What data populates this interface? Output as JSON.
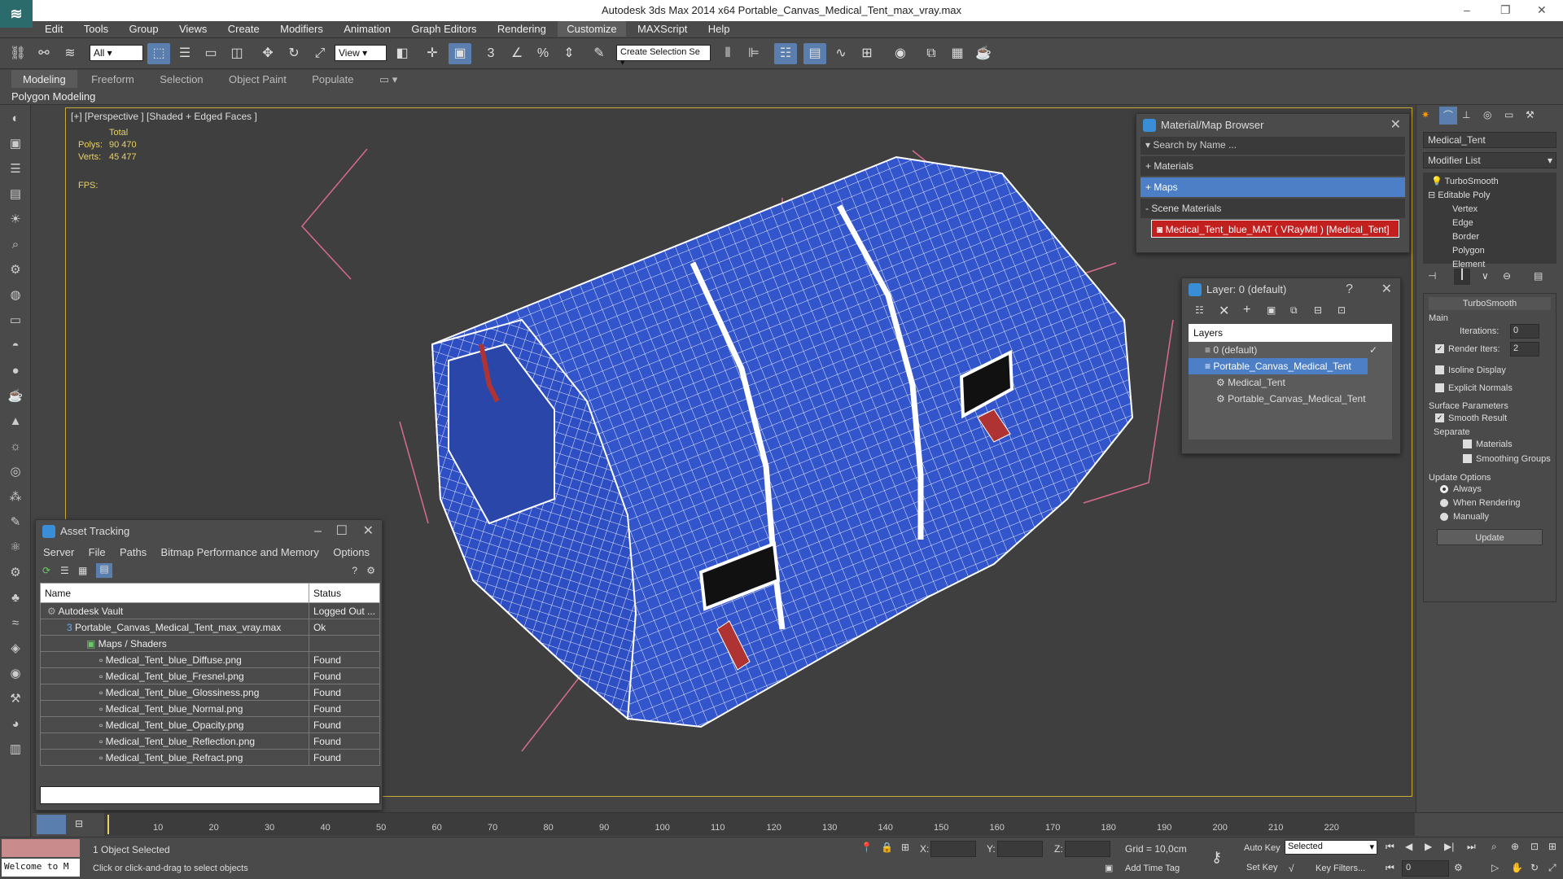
{
  "titlebar": {
    "title": "Autodesk 3ds Max  2014 x64     Portable_Canvas_Medical_Tent_max_vray.max"
  },
  "menu": [
    "Edit",
    "Tools",
    "Group",
    "Views",
    "Create",
    "Modifiers",
    "Animation",
    "Graph Editors",
    "Rendering",
    "Customize",
    "MAXScript",
    "Help"
  ],
  "toolbar": {
    "selection_filter": "All",
    "ref_coord": "View",
    "named_selection": "Create Selection Se"
  },
  "ribbon": {
    "tabs": [
      "Modeling",
      "Freeform",
      "Selection",
      "Object Paint",
      "Populate"
    ],
    "sub": "Polygon Modeling"
  },
  "viewport": {
    "label": "[+] [Perspective ] [Shaded + Edged Faces ]",
    "total": "Total",
    "polys_label": "Polys:",
    "polys": "90 470",
    "verts_label": "Verts:",
    "verts": "45 477",
    "fps_label": "FPS:"
  },
  "asset_tracking": {
    "title": "Asset Tracking",
    "menu": [
      "Server",
      "File",
      "Paths",
      "Bitmap Performance and Memory",
      "Options"
    ],
    "col_name": "Name",
    "col_status": "Status",
    "rows": [
      {
        "name": "Autodesk Vault",
        "status": "Logged Out ..."
      },
      {
        "name": "Portable_Canvas_Medical_Tent_max_vray.max",
        "status": "Ok"
      },
      {
        "name": "Maps / Shaders",
        "status": ""
      },
      {
        "name": "Medical_Tent_blue_Diffuse.png",
        "status": "Found"
      },
      {
        "name": "Medical_Tent_blue_Fresnel.png",
        "status": "Found"
      },
      {
        "name": "Medical_Tent_blue_Glossiness.png",
        "status": "Found"
      },
      {
        "name": "Medical_Tent_blue_Normal.png",
        "status": "Found"
      },
      {
        "name": "Medical_Tent_blue_Opacity.png",
        "status": "Found"
      },
      {
        "name": "Medical_Tent_blue_Reflection.png",
        "status": "Found"
      },
      {
        "name": "Medical_Tent_blue_Refract.png",
        "status": "Found"
      }
    ]
  },
  "material_browser": {
    "title": "Material/Map Browser",
    "search": "Search by Name ...",
    "materials": "+ Materials",
    "maps": "+ Maps",
    "scene": "- Scene Materials",
    "item": "Medical_Tent_blue_MAT ( VRayMtl ) [Medical_Tent]"
  },
  "layer_window": {
    "title": "Layer: 0 (default)",
    "help": "?",
    "header": "Layers",
    "items": [
      "0 (default)",
      "Portable_Canvas_Medical_Tent",
      "Medical_Tent",
      "Portable_Canvas_Medical_Tent"
    ]
  },
  "command_panel": {
    "object_name": "Medical_Tent",
    "modifier_list": "Modifier List",
    "stack": [
      "TurboSmooth",
      "Editable Poly",
      "Vertex",
      "Edge",
      "Border",
      "Polygon",
      "Element"
    ],
    "rollout": "TurboSmooth",
    "main": "Main",
    "iterations_label": "Iterations:",
    "iterations": "0",
    "render_iters_label": "Render Iters:",
    "render_iters": "2",
    "isoline": "Isoline Display",
    "explicit": "Explicit Normals",
    "surface": "Surface Parameters",
    "smooth_result": "Smooth Result",
    "separate": "Separate",
    "materials": "Materials",
    "smoothing_groups": "Smoothing Groups",
    "update_options": "Update Options",
    "always": "Always",
    "when_rendering": "When Rendering",
    "manually": "Manually",
    "update_btn": "Update"
  },
  "timeline": {
    "ticks": [
      "10",
      "20",
      "30",
      "40",
      "50",
      "60",
      "70",
      "80",
      "90",
      "100",
      "110",
      "120",
      "130",
      "140",
      "150",
      "160",
      "170",
      "180",
      "190",
      "200",
      "210",
      "220"
    ]
  },
  "status": {
    "maxscript": "Welcome to M",
    "selected": "1 Object Selected",
    "prompt": "Click or click-and-drag to select objects",
    "x": "X:",
    "y": "Y:",
    "z": "Z:",
    "grid": "Grid = 10,0cm",
    "add_time_tag": "Add Time Tag",
    "auto_key": "Auto Key",
    "set_key": "Set Key",
    "key_mode": "Selected",
    "key_filters": "Key Filters...",
    "frame": "0"
  },
  "colors": {
    "accent": "#5a7fae",
    "viewport_border": "#c8a93c",
    "tent_blue": "#3355cc"
  }
}
